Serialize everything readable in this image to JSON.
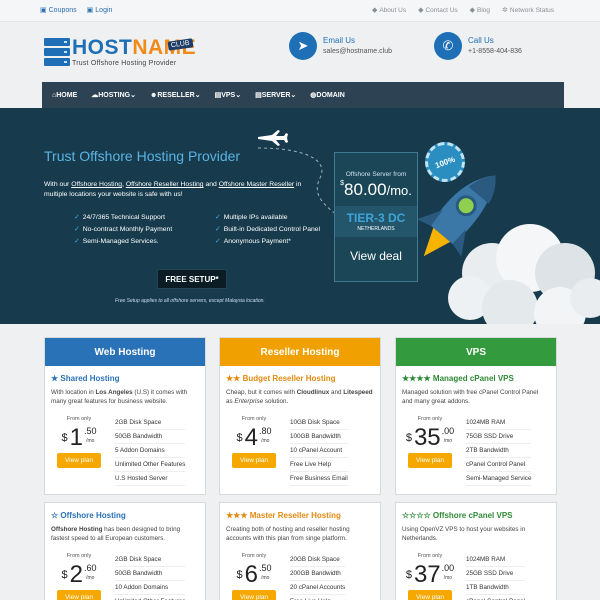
{
  "topbar": {
    "left": [
      {
        "icon": "tag-icon",
        "label": "Coupons"
      },
      {
        "icon": "lock-icon",
        "label": "Login"
      }
    ],
    "right": [
      {
        "icon": "tag-icon",
        "label": "About Us"
      },
      {
        "icon": "tag-icon",
        "label": "Contact Us"
      },
      {
        "icon": "tag-icon",
        "label": "Blog"
      },
      {
        "icon": "network-icon",
        "label": "Network Status"
      }
    ]
  },
  "logo": {
    "host": "HOST",
    "name": "NAME",
    "club": "CLUB",
    "tagline": "Trust Offshore Hosting Provider"
  },
  "email": {
    "label": "Email Us",
    "value": "sales@hostname.club"
  },
  "phone": {
    "label": "Call Us",
    "value": "+1-8558-404-836"
  },
  "nav": [
    {
      "label": "HOME",
      "icon": "home-icon"
    },
    {
      "label": "HOSTING",
      "icon": "cloud-icon",
      "caret": "⌄"
    },
    {
      "label": "RESELLER",
      "icon": "users-icon",
      "caret": "⌄"
    },
    {
      "label": "VPS",
      "icon": "server-icon",
      "caret": "⌄"
    },
    {
      "label": "SERVER",
      "icon": "server-icon",
      "caret": "⌄"
    },
    {
      "label": "DOMAIN",
      "icon": "globe-icon"
    }
  ],
  "hero": {
    "title": "Trust Offshore Hosting Provider",
    "desc_pre": "With our ",
    "link1": "Offshore Hosting",
    "sep1": ", ",
    "link2": "Offshore Reseller Hosting",
    "sep2": " and ",
    "link3": "Offshore Master Reseller",
    "desc_post": " in multiple locations your website is safe with us!",
    "features_left": [
      "24/7/365 Technical Support",
      "No-contract Monthly Payment",
      "Semi-Managed Services."
    ],
    "features_right": [
      "Multiple IPs available",
      "Built-in Dedicated Control Panel",
      "Anonymous Payment*"
    ],
    "setup": "FREE SETUP*",
    "note": "Free Setup applies to all offshore servers, except Malaysia location.",
    "offer_from": "Offshore Server from",
    "offer_dollar": "$",
    "offer_price": "80.00",
    "offer_per": "/mo.",
    "tier": "TIER-3 DC",
    "tier_loc": "NETHERLANDS",
    "view": "View deal",
    "badge": "100%"
  },
  "columns": [
    {
      "title": "Web Hosting",
      "color": "blue",
      "plans": [
        {
          "stars": "★",
          "name": "Shared Hosting",
          "desc": "With location in Los Angeles (U.S) it comes with many great features for business website.",
          "from": "From only",
          "dollar": "$",
          "int": "1",
          "dec": ".50",
          "per": "/mo",
          "btn": "View plan",
          "features": [
            "2GB Disk Space",
            "50GB Bandwidth",
            "5 Addon Domains",
            "Unlimited Other Features",
            "U.S Hosted Server"
          ]
        },
        {
          "stars": "☆",
          "name": "Offshore Hosting",
          "desc": "Offshore Hosting has been designed to bring fastest speed to all European customers.",
          "from": "From only",
          "dollar": "$",
          "int": "2",
          "dec": ".60",
          "per": "/mo",
          "btn": "View plan",
          "features": [
            "2GB Disk Space",
            "50GB Bandwidth",
            "10 Addon Domains",
            "Unlimited Other Features"
          ]
        }
      ]
    },
    {
      "title": "Reseller Hosting",
      "color": "orange",
      "plans": [
        {
          "stars": "★★",
          "name": "Budget Reseller Hosting",
          "desc": "Cheap, but it comes with Cloudlinux and Litespeed as Enterprise solution.",
          "from": "From only",
          "dollar": "$",
          "int": "4",
          "dec": ".80",
          "per": "/mo",
          "btn": "View plan",
          "features": [
            "10GB Disk Space",
            "100GB Bandwidth",
            "10 cPanel Account",
            "Free Live Help",
            "Free Business Email"
          ]
        },
        {
          "stars": "★★★",
          "name": "Master Reseller Hosting",
          "desc": "Creating both of hosting and reseller hosting accounts with this plan from singe platform.",
          "from": "From only",
          "dollar": "$",
          "int": "6",
          "dec": ".50",
          "per": "/mo",
          "btn": "View plan",
          "features": [
            "20GB Disk Space",
            "200GB Bandwidth",
            "20 cPanel Accounts",
            "Free Live Help"
          ]
        }
      ]
    },
    {
      "title": "VPS",
      "color": "green",
      "plans": [
        {
          "stars": "★★★★",
          "name": "Managed cPanel VPS",
          "desc": "Managed solution with free cPanel Control Panel and many great addons.",
          "from": "From only",
          "dollar": "$",
          "int": "35",
          "dec": ".00",
          "per": "/mo",
          "btn": "View plan",
          "features": [
            "1024MB RAM",
            "75GB SSD Drive",
            "2TB Bandwidth",
            "cPanel Control Panel",
            "Semi-Managed Service"
          ]
        },
        {
          "stars": "☆☆☆☆",
          "name": "Offshore cPanel VPS",
          "desc": "Using OpenVZ VPS to host your websites in Netherlands.",
          "from": "From only",
          "dollar": "$",
          "int": "37",
          "dec": ".00",
          "per": "/mo",
          "btn": "View plan",
          "features": [
            "1024MB RAM",
            "25GB SSD Drive",
            "1TB Bandwidth",
            "cPanel Control Panel"
          ]
        }
      ]
    }
  ]
}
